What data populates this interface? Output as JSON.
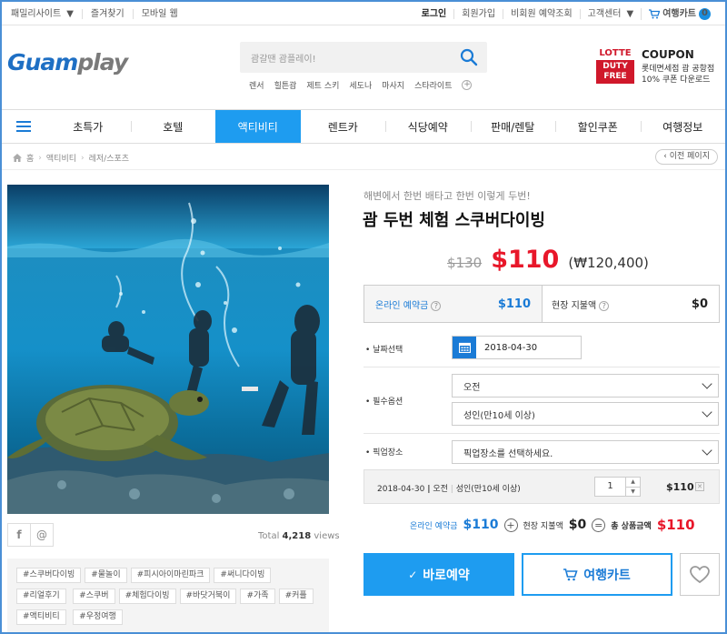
{
  "util": {
    "family_site": "패밀리사이트",
    "bookmark": "즐겨찾기",
    "mobile_web": "모바일 웹",
    "login": "로그인",
    "signup": "회원가입",
    "guest_lookup": "비회원 예약조회",
    "customer_center": "고객센터",
    "cart": "여행카트",
    "cart_count": "0"
  },
  "header": {
    "logo_a": "Guam",
    "logo_b": "play",
    "search_placeholder": "괌갈땐 괌플레이!",
    "tags": [
      "렌서",
      "힐튼괌",
      "제트 스키",
      "세도나",
      "마사지",
      "스타라이트"
    ],
    "lotte_top": "LOTTE",
    "lotte_mid": "DUTY",
    "lotte_bot": "FREE",
    "coupon_title": "COUPON",
    "coupon_line1": "롯데면세점 괌 공항점",
    "coupon_line2": "10% 쿠폰 다운로드"
  },
  "nav": {
    "items": [
      "초특가",
      "호텔",
      "액티비티",
      "렌트카",
      "식당예약",
      "판매/렌탈",
      "할인쿠폰",
      "여행정보"
    ]
  },
  "breadcrumb": {
    "home": "홈",
    "level1": "액티비티",
    "level2": "레저/스포츠",
    "prev_page": "이전 페이지"
  },
  "product": {
    "subtitle": "해변에서 한번 배타고 한번 이렇게 두번!",
    "title": "괌 두번 체험 스쿠버다이빙",
    "orig_price": "$130",
    "sale_price": "$110",
    "krw_price": "(₩120,400)",
    "online_deposit_label": "온라인 예약금",
    "online_deposit_value": "$110",
    "onsite_label": "현장 지불액",
    "onsite_value": "$0"
  },
  "form": {
    "date_label": "날짜선택",
    "date_value": "2018-04-30",
    "options_label": "필수옵션",
    "option1": "오전",
    "option2": "성인(만10세 이상)",
    "pickup_label": "픽업장소",
    "pickup_value": "픽업장소를 선택하세요."
  },
  "selected": {
    "date": "2018-04-30",
    "time": "오전",
    "type": "성인(만10세 이상)",
    "qty": "1",
    "price": "$110"
  },
  "totals": {
    "online_label": "온라인 예약금",
    "online_value": "$110",
    "onsite_label": "현장 지불액",
    "onsite_value": "$0",
    "total_label": "총 상품금액",
    "total_value": "$110"
  },
  "buttons": {
    "book": "바로예약",
    "cart": "여행카트"
  },
  "meta": {
    "views_prefix": "Total",
    "views_count": "4,218",
    "views_suffix": "views"
  },
  "hashtags": [
    "#스쿠버다이빙",
    "#물놀이",
    "#피시아이마린파크",
    "#써니다이빙",
    "#리얼후기",
    "#스쿠버",
    "#체험다이빙",
    "#바닷거북이",
    "#가족",
    "#커플",
    "#액티비티",
    "#우정여행"
  ],
  "colors": {
    "brand_blue": "#1e9cf0",
    "sale_red": "#e8172a",
    "lotte_red": "#d0182b"
  }
}
